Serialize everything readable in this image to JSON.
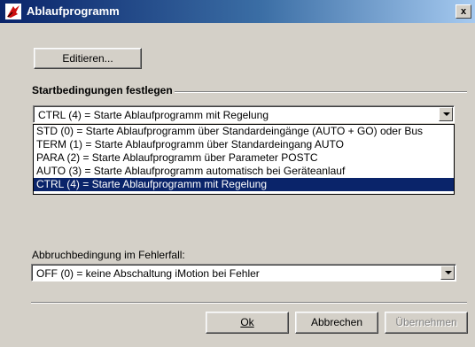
{
  "window": {
    "title": "Ablaufprogramm",
    "close_label": "x"
  },
  "toolbar": {
    "edit_label": "Editieren..."
  },
  "start": {
    "group_label": "Startbedingungen festlegen",
    "selected": "CTRL (4) = Starte Ablaufprogramm mit Regelung",
    "options": [
      "STD (0) = Starte Ablaufprogramm über Standardeingänge (AUTO + GO) oder Bus",
      "TERM (1) = Starte Ablaufprogramm über Standardeingang AUTO",
      "PARA (2) = Starte Ablaufprogramm über Parameter POSTC",
      "AUTO (3) = Starte Ablaufprogramm automatisch bei Geräteanlauf",
      "CTRL (4) = Starte Ablaufprogramm mit Regelung"
    ]
  },
  "abort": {
    "label": "Abbruchbedingung im Fehlerfall:",
    "selected": "OFF (0) = keine Abschaltung iMotion bei Fehler"
  },
  "buttons": {
    "ok_label": "Ok",
    "cancel_label": "Abbrechen",
    "apply_label": "Übernehmen"
  }
}
